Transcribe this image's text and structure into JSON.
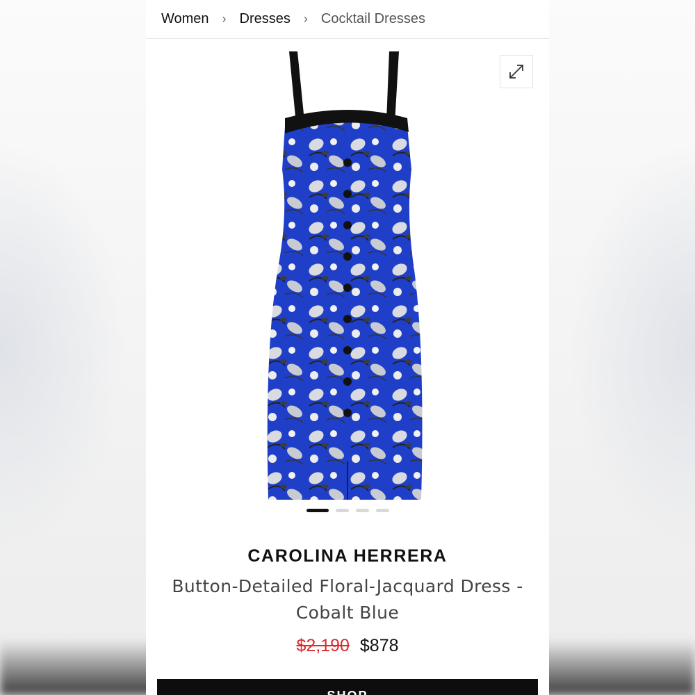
{
  "breadcrumb": {
    "items": [
      "Women",
      "Dresses",
      "Cocktail Dresses"
    ],
    "separator": "›"
  },
  "gallery": {
    "expand_icon": "expand-arrows-icon",
    "dots_total": 4,
    "dots_active_index": 0
  },
  "product": {
    "brand": "CAROLINA HERRERA",
    "title": "Button-Detailed Floral-Jacquard Dress - Cobalt Blue",
    "original_price": "$2,190",
    "sale_price": "$878"
  },
  "cta": {
    "shop_label": "SHOP"
  },
  "colors": {
    "sale_red": "#d92d2d",
    "cobalt_blue": "#1e3fc9",
    "button_black": "#0d0d0d"
  }
}
